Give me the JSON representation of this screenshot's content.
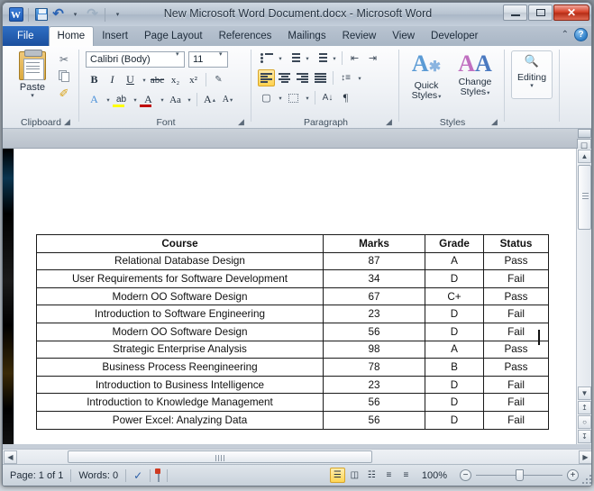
{
  "window": {
    "title": "New Microsoft Word Document.docx - Microsoft Word",
    "app_logo": "word-logo-w",
    "minimize_label": "–",
    "maximize_label": "□",
    "close_label": "✕"
  },
  "quick_access": {
    "items": [
      {
        "name": "save",
        "icon": "save-icon"
      },
      {
        "name": "undo",
        "icon": "undo-icon",
        "glyph": "↶"
      },
      {
        "name": "redo",
        "icon": "redo-icon",
        "glyph": "↷"
      },
      {
        "name": "customize",
        "icon": "chevron-down-icon",
        "glyph": "▾"
      }
    ]
  },
  "ribbon": {
    "tabs": [
      {
        "label": "File",
        "active": false,
        "kind": "file"
      },
      {
        "label": "Home",
        "active": true
      },
      {
        "label": "Insert",
        "active": false
      },
      {
        "label": "Page Layout",
        "active": false
      },
      {
        "label": "References",
        "active": false
      },
      {
        "label": "Mailings",
        "active": false
      },
      {
        "label": "Review",
        "active": false
      },
      {
        "label": "View",
        "active": false
      },
      {
        "label": "Developer",
        "active": false
      }
    ],
    "minimize_ribbon_glyph": "⌃",
    "help_glyph": "?",
    "groups": {
      "clipboard": {
        "label": "Clipboard",
        "paste_label": "Paste",
        "paste_arrow": "▾",
        "cut_glyph": "✂",
        "copy_name": "copy-icon",
        "format_painter_glyph": "✐",
        "dialog_launcher": "◢"
      },
      "font": {
        "label": "Font",
        "font_name_value": "Calibri (Body)",
        "font_size_value": "11",
        "bold": "B",
        "italic": "I",
        "underline": "U",
        "strikethrough": "abc",
        "subscript": "x₂",
        "superscript": "x²",
        "clear_formatting": "✐",
        "text_effects": "A",
        "highlight": "ab",
        "font_color": "A",
        "change_case": "Aa",
        "grow_font": "A",
        "shrink_font": "A",
        "dialog_launcher": "◢",
        "highlight_color": "#ffff00",
        "font_color_swatch": "#c00000",
        "effects_color": "#3a7bc8"
      },
      "paragraph": {
        "label": "Paragraph",
        "bullets": "bullets-icon",
        "numbering": "numbering-icon",
        "multilevel": "multilevel-list-icon",
        "decrease_indent": "decrease-indent-icon",
        "increase_indent": "increase-indent-icon",
        "align_left": "align-left-icon",
        "align_center": "align-center-icon",
        "align_right": "align-right-icon",
        "justify": "justify-icon",
        "line_spacing": "line-spacing-icon",
        "shading": "shading-icon",
        "borders": "borders-icon",
        "sort": "sort-icon",
        "show_marks": "¶",
        "dialog_launcher": "◢"
      },
      "styles": {
        "label": "Styles",
        "quick_styles_line1": "Quick",
        "quick_styles_line2": "Styles",
        "change_styles_line1": "Change",
        "change_styles_line2": "Styles",
        "arrow": "▾",
        "dialog_launcher": "◢"
      },
      "editing": {
        "label": "",
        "editing_label": "Editing",
        "arrow": "▾",
        "glyph": "☎"
      }
    }
  },
  "document": {
    "table": {
      "headers": [
        "Course",
        "Marks",
        "Grade",
        "Status"
      ],
      "rows": [
        [
          "Relational Database Design",
          "87",
          "A",
          "Pass"
        ],
        [
          "User Requirements for Software Development",
          "34",
          "D",
          "Fail"
        ],
        [
          "Modern OO Software Design",
          "67",
          "C+",
          "Pass"
        ],
        [
          "Introduction to Software Engineering",
          "23",
          "D",
          "Fail"
        ],
        [
          "Modern OO Software Design",
          "56",
          "D",
          "Fail"
        ],
        [
          "Strategic Enterprise Analysis",
          "98",
          "A",
          "Pass"
        ],
        [
          "Business Process Reengineering",
          "78",
          "B",
          "Pass"
        ],
        [
          "Introduction to Business Intelligence",
          "23",
          "D",
          "Fail"
        ],
        [
          "Introduction to Knowledge Management",
          "56",
          "D",
          "Fail"
        ],
        [
          "Power Excel: Analyzing Data",
          "56",
          "D",
          "Fail"
        ]
      ]
    }
  },
  "scrollbars": {
    "v_up": "▲",
    "v_down": "▼",
    "v_prev_page": "↥",
    "v_select_object": "○",
    "v_next_page": "↧",
    "h_left": "◀",
    "h_right": "▶",
    "split_handle": "split-handle",
    "browse_object": "browse-object-icon"
  },
  "statusbar": {
    "page_label": "Page: 1 of 1",
    "words_label": "Words: 0",
    "proofing_icon": "spell-check-icon",
    "language_icon": "proofing-errors-icon",
    "views": [
      {
        "name": "print-layout",
        "glyph": "☰",
        "active": true
      },
      {
        "name": "full-screen-reading",
        "glyph": "◫",
        "active": false
      },
      {
        "name": "web-layout",
        "glyph": "☷",
        "active": false
      },
      {
        "name": "outline",
        "glyph": "≡",
        "active": false
      },
      {
        "name": "draft",
        "glyph": "≡",
        "active": false
      }
    ],
    "zoom_value": "100%",
    "zoom_out": "−",
    "zoom_in": "+"
  }
}
